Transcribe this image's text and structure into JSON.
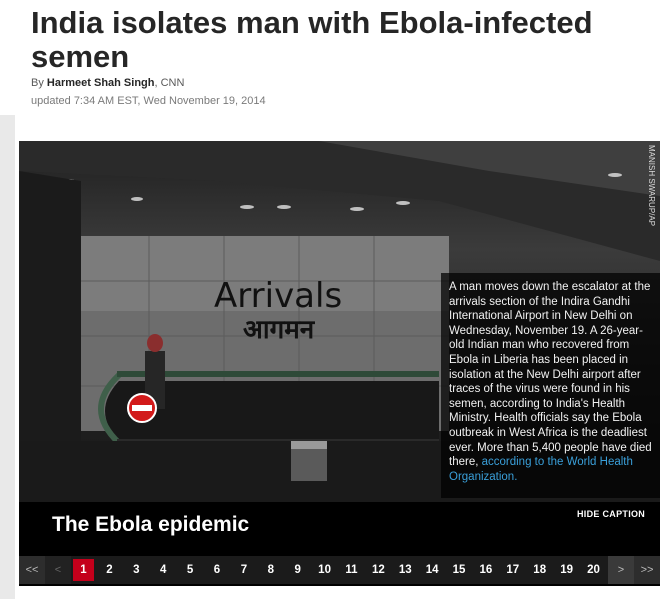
{
  "article": {
    "headline": "India isolates man with Ebola-infected semen",
    "byline_prefix": "By ",
    "author": "Harmeet Shah Singh",
    "source": ", CNN",
    "updated": "updated 7:34 AM EST, Wed November 19, 2014"
  },
  "gallery": {
    "photo_credit": "MANISH SWARUP/AP",
    "photo_text_english": "Arrivals",
    "photo_text_hindi": "आगमन",
    "caption_text": "A man moves down the escalator at the arrivals section of the Indira Gandhi International Airport in New Delhi on Wednesday, November 19. A 26-year-old Indian man who recovered from Ebola in Liberia has been placed in isolation at the New Delhi airport after traces of the virus were found in his semen, according to India's Health Ministry. Health officials say the Ebola outbreak in West Africa is the deadliest ever. More than 5,400 people have died there, ",
    "caption_link": "according to the World Health Organization.",
    "title": "The Ebola epidemic",
    "hide_caption_label": "HIDE CAPTION"
  },
  "pager": {
    "first_label": "<<",
    "prev_label": "<",
    "next_label": ">",
    "last_label": ">>",
    "pages": [
      "1",
      "2",
      "3",
      "4",
      "5",
      "6",
      "7",
      "8",
      "9",
      "10",
      "11",
      "12",
      "13",
      "14",
      "15",
      "16",
      "17",
      "18",
      "19",
      "20"
    ],
    "current_page": "1"
  },
  "colors": {
    "accent_red": "#c4001b",
    "link_blue": "#3a9fd9"
  }
}
